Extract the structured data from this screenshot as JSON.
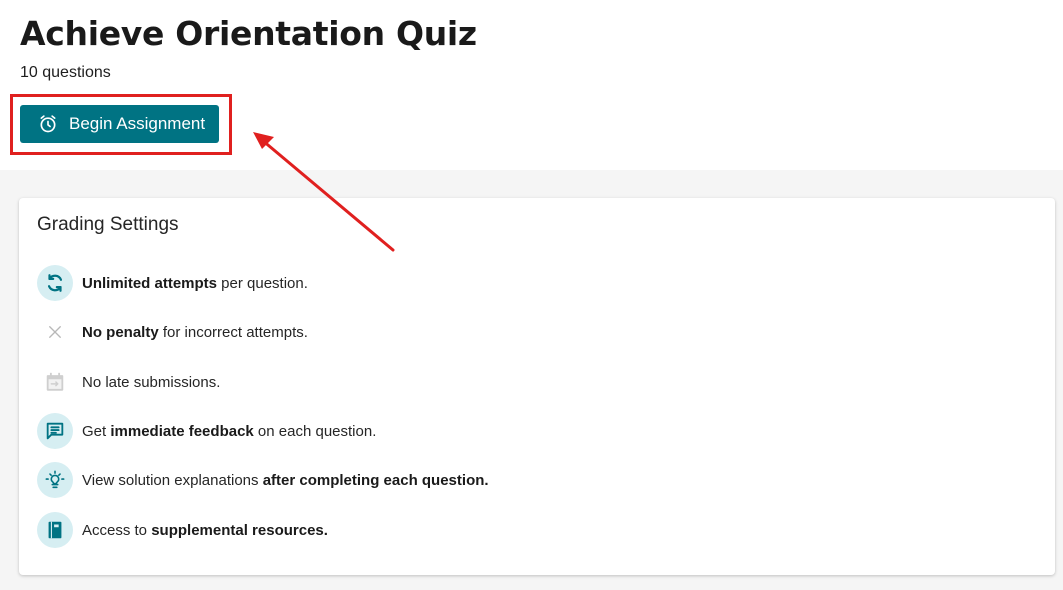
{
  "header": {
    "title": "Achieve Orientation Quiz",
    "question_count": "10 questions",
    "begin_button_label": "Begin Assignment"
  },
  "grading": {
    "title": "Grading Settings",
    "items": [
      {
        "icon": "refresh-icon",
        "bold_before": "Unlimited attempts",
        "text_after": " per question.",
        "pre": ""
      },
      {
        "icon": "close-icon",
        "bold_before": "No penalty",
        "text_after": " for incorrect attempts.",
        "pre": ""
      },
      {
        "icon": "calendar-icon",
        "bold_before": "",
        "text_after": "No late submissions.",
        "pre": ""
      },
      {
        "icon": "feedback-icon",
        "pre": "Get ",
        "bold_before": "immediate feedback",
        "text_after": " on each question."
      },
      {
        "icon": "lightbulb-icon",
        "pre": "View solution explanations ",
        "bold_before": "after completing each question.",
        "text_after": ""
      },
      {
        "icon": "book-icon",
        "pre": "Access to ",
        "bold_before": "supplemental resources.",
        "text_after": ""
      }
    ]
  },
  "colors": {
    "accent": "#007383",
    "icon_bg": "#d6eef2",
    "annotation_red": "#e0201f"
  }
}
